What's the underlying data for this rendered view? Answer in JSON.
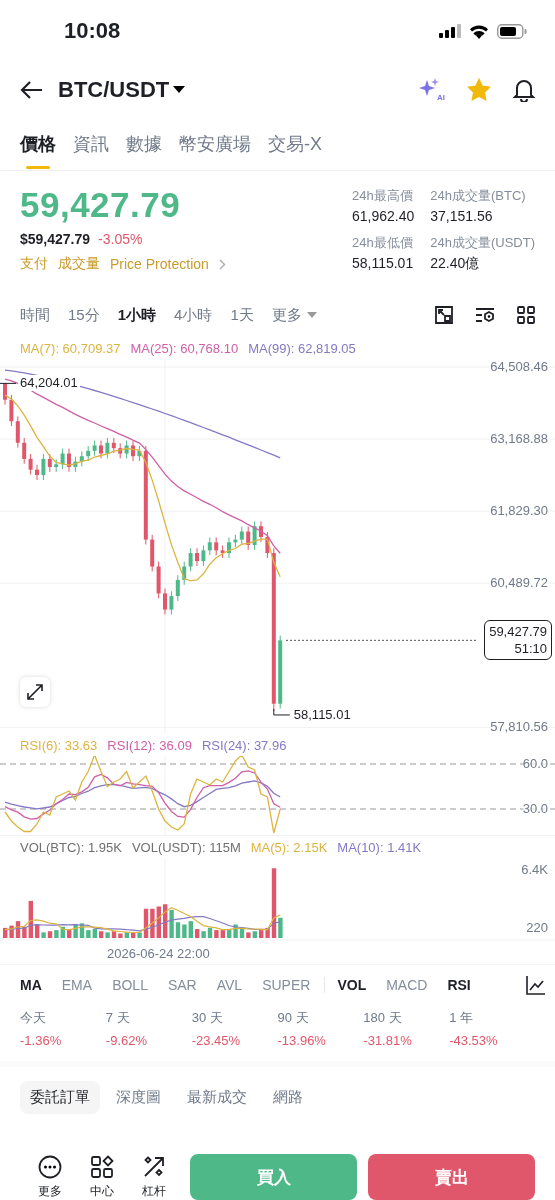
{
  "status_bar": {
    "time": "10:08"
  },
  "header": {
    "pair": "BTC/USDT",
    "ai_badge": "AI",
    "favorite": true
  },
  "tabs": [
    {
      "label": "價格",
      "selected": true
    },
    {
      "label": "資訊",
      "selected": false
    },
    {
      "label": "數據",
      "selected": false
    },
    {
      "label": "幣安廣場",
      "selected": false
    },
    {
      "label": "交易-X",
      "selected": false
    }
  ],
  "price": {
    "last": "59,427.79",
    "usd": "$59,427.79",
    "change": "-3.05%",
    "links": [
      "支付",
      "成交量",
      "Price Protection"
    ]
  },
  "stats": [
    {
      "label": "24h最高價",
      "value": "61,962.40"
    },
    {
      "label": "24h成交量(BTC)",
      "value": "37,151.56"
    },
    {
      "label": "24h最低價",
      "value": "58,115.01"
    },
    {
      "label": "24h成交量(USDT)",
      "value": "22.40億"
    }
  ],
  "intervals": [
    {
      "label": "時間",
      "selected": false
    },
    {
      "label": "15分",
      "selected": false
    },
    {
      "label": "1小時",
      "selected": true
    },
    {
      "label": "4小時",
      "selected": false
    },
    {
      "label": "1天",
      "selected": false
    },
    {
      "label": "更多",
      "selected": false
    }
  ],
  "ma_legend": [
    {
      "label": "MA(7): 60,709.37",
      "color": "#dcb440"
    },
    {
      "label": "MA(25): 60,768.10",
      "color": "#d05fa6"
    },
    {
      "label": "MA(99): 62,819.05",
      "color": "#8479c4"
    }
  ],
  "price_axis": [
    "64,508.46",
    "63,168.88",
    "61,829.30",
    "60,489.72",
    "57,810.56"
  ],
  "high_marker": "64,204.01",
  "low_marker": "58,115.01",
  "current_price": {
    "price": "59,427.79",
    "countdown": "51:10"
  },
  "rsi_legend": [
    {
      "label": "RSI(6): 33.63",
      "color": "#dcb440"
    },
    {
      "label": "RSI(12): 36.09",
      "color": "#d05fa6"
    },
    {
      "label": "RSI(24): 37.96",
      "color": "#8479c4"
    }
  ],
  "rsi_axis": [
    "60.0",
    "30.0"
  ],
  "vol_legend": [
    {
      "label": "VOL(BTC): 1.95K",
      "color": "#6f6f6f"
    },
    {
      "label": "VOL(USDT): 115M",
      "color": "#6f6f6f"
    },
    {
      "label": "MA(5): 2.15K",
      "color": "#dcb440"
    },
    {
      "label": "MA(10): 1.41K",
      "color": "#8479c4"
    }
  ],
  "vol_axis": [
    "6.4K",
    "220"
  ],
  "time_label": "2026-06-24 22:00",
  "main_indicators": [
    {
      "label": "MA",
      "selected": true
    },
    {
      "label": "EMA",
      "selected": false
    },
    {
      "label": "BOLL",
      "selected": false
    },
    {
      "label": "SAR",
      "selected": false
    },
    {
      "label": "AVL",
      "selected": false
    },
    {
      "label": "SUPER",
      "selected": false
    }
  ],
  "sub_indicators": [
    {
      "label": "VOL",
      "selected": true
    },
    {
      "label": "MACD",
      "selected": false
    },
    {
      "label": "RSI",
      "selected": true
    }
  ],
  "performance": [
    {
      "period": "今天",
      "change": "-1.36%"
    },
    {
      "period": "7 天",
      "change": "-9.62%"
    },
    {
      "period": "30 天",
      "change": "-23.45%"
    },
    {
      "period": "90 天",
      "change": "-13.96%"
    },
    {
      "period": "180 天",
      "change": "-31.81%"
    },
    {
      "period": "1 年",
      "change": "-43.53%"
    }
  ],
  "bottom_tabs": [
    {
      "label": "委託訂單",
      "selected": true
    },
    {
      "label": "深度圖",
      "selected": false
    },
    {
      "label": "最新成交",
      "selected": false
    },
    {
      "label": "網路",
      "selected": false
    }
  ],
  "tools": [
    {
      "label": "更多",
      "kind": "more"
    },
    {
      "label": "中心",
      "kind": "center"
    },
    {
      "label": "杠杆",
      "kind": "leverage"
    }
  ],
  "actions": {
    "buy": "買入",
    "sell": "賣出"
  }
}
